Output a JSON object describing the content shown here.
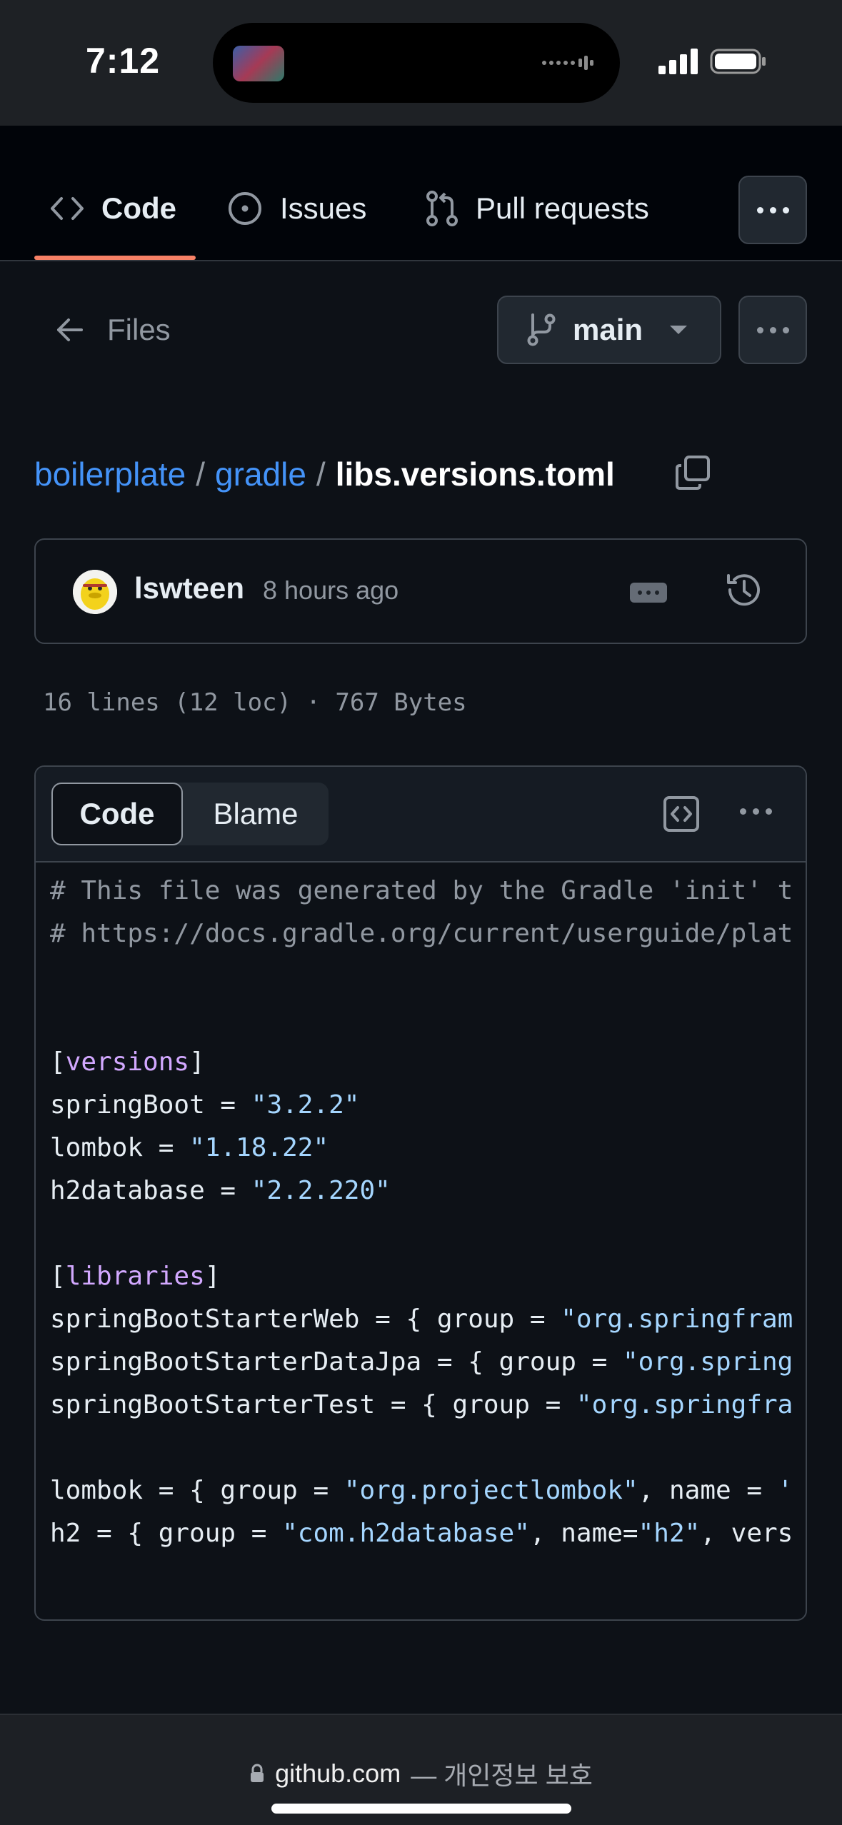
{
  "status_bar": {
    "time": "7:12"
  },
  "nav": {
    "tabs": [
      {
        "label": "Code",
        "icon": "code-icon",
        "active": true
      },
      {
        "label": "Issues",
        "icon": "issue-opened-icon",
        "active": false
      },
      {
        "label": "Pull requests",
        "icon": "git-pull-request-icon",
        "active": false
      }
    ],
    "more_icon": "kebab-horizontal-icon"
  },
  "toolbar": {
    "back_label": "Files",
    "branch": "main"
  },
  "breadcrumb": {
    "repo": "boilerplate",
    "folder": "gradle",
    "separator": "/",
    "file": "libs.versions.toml"
  },
  "commit": {
    "author": "lswteen",
    "time": "8 hours ago"
  },
  "file_meta": "16 lines (12 loc) · 767 Bytes",
  "code_view": {
    "tabs": [
      "Code",
      "Blame"
    ],
    "active_tab": "Code",
    "lines": [
      [
        {
          "t": "# This file was generated by the Gradle 'init' t",
          "c": "comment"
        }
      ],
      [
        {
          "t": "# https://docs.gradle.org/current/userguide/plat",
          "c": "comment"
        }
      ],
      [],
      [],
      [
        {
          "t": "[",
          "c": "plain"
        },
        {
          "t": "versions",
          "c": "section"
        },
        {
          "t": "]",
          "c": "plain"
        }
      ],
      [
        {
          "t": "springBoot = ",
          "c": "plain"
        },
        {
          "t": "\"3.2.2\"",
          "c": "string"
        }
      ],
      [
        {
          "t": "lombok = ",
          "c": "plain"
        },
        {
          "t": "\"1.18.22\"",
          "c": "string"
        }
      ],
      [
        {
          "t": "h2database = ",
          "c": "plain"
        },
        {
          "t": "\"2.2.220\"",
          "c": "string"
        }
      ],
      [],
      [
        {
          "t": "[",
          "c": "plain"
        },
        {
          "t": "libraries",
          "c": "section"
        },
        {
          "t": "]",
          "c": "plain"
        }
      ],
      [
        {
          "t": "springBootStarterWeb = { group = ",
          "c": "plain"
        },
        {
          "t": "\"org.springfram",
          "c": "string"
        }
      ],
      [
        {
          "t": "springBootStarterDataJpa = { group = ",
          "c": "plain"
        },
        {
          "t": "\"org.spring",
          "c": "string"
        }
      ],
      [
        {
          "t": "springBootStarterTest = { group = ",
          "c": "plain"
        },
        {
          "t": "\"org.springfra",
          "c": "string"
        }
      ],
      [],
      [
        {
          "t": "lombok = { group = ",
          "c": "plain"
        },
        {
          "t": "\"org.projectlombok\"",
          "c": "string"
        },
        {
          "t": ", name = ",
          "c": "plain"
        },
        {
          "t": "'",
          "c": "string"
        }
      ],
      [
        {
          "t": "h2 = { group = ",
          "c": "plain"
        },
        {
          "t": "\"com.h2database\"",
          "c": "string"
        },
        {
          "t": ", name=",
          "c": "plain"
        },
        {
          "t": "\"h2\"",
          "c": "string"
        },
        {
          "t": ", vers",
          "c": "plain"
        }
      ]
    ]
  },
  "browser": {
    "host": "github.com",
    "suffix": "— 개인정보 보호"
  },
  "colors": {
    "link": "#4493f8",
    "active_underline": "#f78166",
    "section": "#d2a8ff",
    "string": "#a5d6ff",
    "comment": "#9198a1"
  }
}
